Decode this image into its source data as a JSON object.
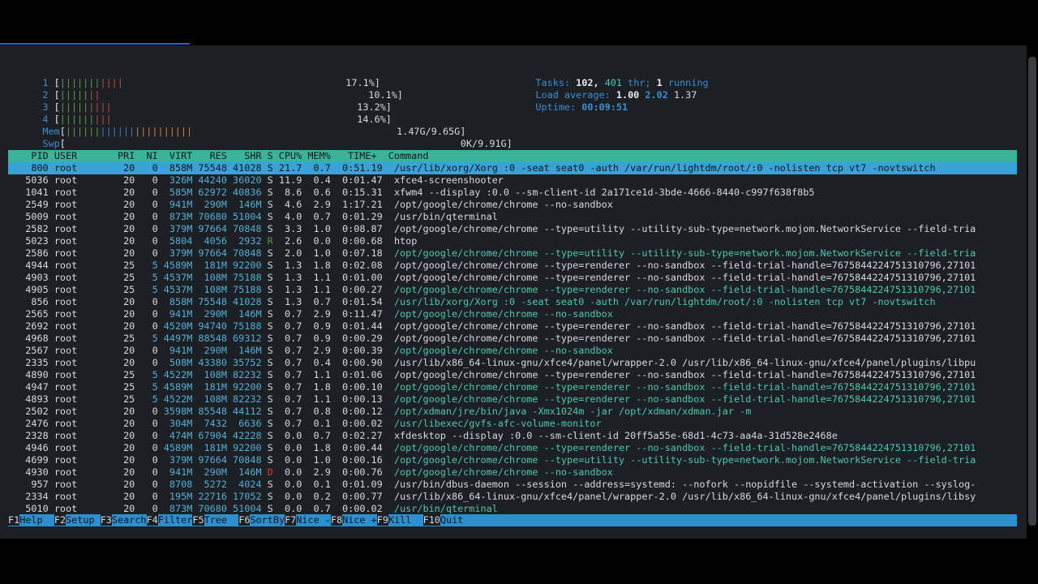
{
  "meters": {
    "cpus": [
      {
        "id": "1",
        "percent": "17.1%]"
      },
      {
        "id": "2",
        "percent": "10.1%]"
      },
      {
        "id": "3",
        "percent": "13.2%]"
      },
      {
        "id": "4",
        "percent": "14.6%]"
      }
    ],
    "mem": {
      "label": "Mem",
      "value": "1.47G/9.65G]"
    },
    "swp": {
      "label": "Swp",
      "value": "0K/9.91G]"
    },
    "tasks_label": "Tasks:",
    "tasks_count": "102,",
    "threads": "401",
    "thr_label": "thr;",
    "running": "1",
    "running_label": "running",
    "load_label": "Load average:",
    "load1": "1.00",
    "load5": "2.02",
    "load15": "1.37",
    "uptime_label": "Uptime:",
    "uptime": "00:09:51"
  },
  "header": "    PID USER       PRI  NI  VIRT   RES   SHR S CPU% MEM%   TIME+  Command",
  "processes": [
    {
      "pid": "800",
      "user": "root",
      "pri": "20",
      "ni": "0",
      "virt": "858M",
      "res": "75548",
      "shr": "41028",
      "s": "S",
      "cpu": "21.7",
      "mem": "0.7",
      "time": "0:51.19",
      "cmd": "/usr/lib/xorg/Xorg :0 -seat seat0 -auth /var/run/lightdm/root/:0 -nolisten tcp vt7 -novtswitch",
      "thread": false,
      "selected": true
    },
    {
      "pid": "5036",
      "user": "root",
      "pri": "20",
      "ni": "0",
      "virt": "326M",
      "res": "44240",
      "shr": "36020",
      "s": "S",
      "cpu": "11.9",
      "mem": "0.4",
      "time": "0:01.47",
      "cmd": "xfce4-screenshooter",
      "thread": false
    },
    {
      "pid": "1041",
      "user": "root",
      "pri": "20",
      "ni": "0",
      "virt": "585M",
      "res": "62972",
      "shr": "40836",
      "s": "S",
      "cpu": "8.6",
      "mem": "0.6",
      "time": "0:15.31",
      "cmd": "xfwm4 --display :0.0 --sm-client-id 2a171ce1d-3bde-4666-8440-c997f638f8b5",
      "thread": false
    },
    {
      "pid": "2549",
      "user": "root",
      "pri": "20",
      "ni": "0",
      "virt": "941M",
      "res": "290M",
      "shr": "146M",
      "s": "S",
      "cpu": "4.6",
      "mem": "2.9",
      "time": "1:17.21",
      "cmd": "/opt/google/chrome/chrome --no-sandbox",
      "thread": false
    },
    {
      "pid": "5009",
      "user": "root",
      "pri": "20",
      "ni": "0",
      "virt": "873M",
      "res": "70680",
      "shr": "51004",
      "s": "S",
      "cpu": "4.0",
      "mem": "0.7",
      "time": "0:01.29",
      "cmd": "/usr/bin/qterminal",
      "thread": false
    },
    {
      "pid": "2582",
      "user": "root",
      "pri": "20",
      "ni": "0",
      "virt": "379M",
      "res": "97664",
      "shr": "70848",
      "s": "S",
      "cpu": "3.3",
      "mem": "1.0",
      "time": "0:08.87",
      "cmd": "/opt/google/chrome/chrome --type=utility --utility-sub-type=network.mojom.NetworkService --field-tria",
      "thread": false
    },
    {
      "pid": "5023",
      "user": "root",
      "pri": "20",
      "ni": "0",
      "virt": "5804",
      "res": "4056",
      "shr": "2932",
      "s": "R",
      "cpu": "2.6",
      "mem": "0.0",
      "time": "0:00.68",
      "cmd": "htop",
      "thread": false
    },
    {
      "pid": "2586",
      "user": "root",
      "pri": "20",
      "ni": "0",
      "virt": "379M",
      "res": "97664",
      "shr": "70848",
      "s": "S",
      "cpu": "2.0",
      "mem": "1.0",
      "time": "0:07.18",
      "cmd": "/opt/google/chrome/chrome --type=utility --utility-sub-type=network.mojom.NetworkService --field-tria",
      "thread": true
    },
    {
      "pid": "4944",
      "user": "root",
      "pri": "25",
      "ni": "5",
      "virt": "4589M",
      "res": "181M",
      "shr": "92200",
      "s": "S",
      "cpu": "1.3",
      "mem": "1.8",
      "time": "0:02.08",
      "cmd": "/opt/google/chrome/chrome --type=renderer --no-sandbox --field-trial-handle=7675844224751310796,27101",
      "thread": false
    },
    {
      "pid": "4903",
      "user": "root",
      "pri": "25",
      "ni": "5",
      "virt": "4537M",
      "res": "108M",
      "shr": "75188",
      "s": "S",
      "cpu": "1.3",
      "mem": "1.1",
      "time": "0:01.00",
      "cmd": "/opt/google/chrome/chrome --type=renderer --no-sandbox --field-trial-handle=7675844224751310796,27101",
      "thread": false
    },
    {
      "pid": "4905",
      "user": "root",
      "pri": "25",
      "ni": "5",
      "virt": "4537M",
      "res": "108M",
      "shr": "75188",
      "s": "S",
      "cpu": "1.3",
      "mem": "1.1",
      "time": "0:00.27",
      "cmd": "/opt/google/chrome/chrome --type=renderer --no-sandbox --field-trial-handle=7675844224751310796,27101",
      "thread": true
    },
    {
      "pid": "856",
      "user": "root",
      "pri": "20",
      "ni": "0",
      "virt": "858M",
      "res": "75548",
      "shr": "41028",
      "s": "S",
      "cpu": "1.3",
      "mem": "0.7",
      "time": "0:01.54",
      "cmd": "/usr/lib/xorg/Xorg :0 -seat seat0 -auth /var/run/lightdm/root/:0 -nolisten tcp vt7 -novtswitch",
      "thread": true
    },
    {
      "pid": "2565",
      "user": "root",
      "pri": "20",
      "ni": "0",
      "virt": "941M",
      "res": "290M",
      "shr": "146M",
      "s": "S",
      "cpu": "0.7",
      "mem": "2.9",
      "time": "0:11.47",
      "cmd": "/opt/google/chrome/chrome --no-sandbox",
      "thread": true
    },
    {
      "pid": "2692",
      "user": "root",
      "pri": "20",
      "ni": "0",
      "virt": "4520M",
      "res": "94740",
      "shr": "75188",
      "s": "S",
      "cpu": "0.7",
      "mem": "0.9",
      "time": "0:01.44",
      "cmd": "/opt/google/chrome/chrome --type=renderer --no-sandbox --field-trial-handle=7675844224751310796,27101",
      "thread": false
    },
    {
      "pid": "4968",
      "user": "root",
      "pri": "25",
      "ni": "5",
      "virt": "4497M",
      "res": "88548",
      "shr": "69312",
      "s": "S",
      "cpu": "0.7",
      "mem": "0.9",
      "time": "0:00.29",
      "cmd": "/opt/google/chrome/chrome --type=renderer --no-sandbox --field-trial-handle=7675844224751310796,27101",
      "thread": false
    },
    {
      "pid": "2567",
      "user": "root",
      "pri": "20",
      "ni": "0",
      "virt": "941M",
      "res": "290M",
      "shr": "146M",
      "s": "S",
      "cpu": "0.7",
      "mem": "2.9",
      "time": "0:00.39",
      "cmd": "/opt/google/chrome/chrome --no-sandbox",
      "thread": true
    },
    {
      "pid": "2335",
      "user": "root",
      "pri": "20",
      "ni": "0",
      "virt": "508M",
      "res": "43380",
      "shr": "35752",
      "s": "S",
      "cpu": "0.7",
      "mem": "0.4",
      "time": "0:00.90",
      "cmd": "/usr/lib/x86_64-linux-gnu/xfce4/panel/wrapper-2.0 /usr/lib/x86_64-linux-gnu/xfce4/panel/plugins/libpu",
      "thread": false
    },
    {
      "pid": "4890",
      "user": "root",
      "pri": "25",
      "ni": "5",
      "virt": "4522M",
      "res": "108M",
      "shr": "82232",
      "s": "S",
      "cpu": "0.7",
      "mem": "1.1",
      "time": "0:01.06",
      "cmd": "/opt/google/chrome/chrome --type=renderer --no-sandbox --field-trial-handle=7675844224751310796,27101",
      "thread": false
    },
    {
      "pid": "4947",
      "user": "root",
      "pri": "25",
      "ni": "5",
      "virt": "4589M",
      "res": "181M",
      "shr": "92200",
      "s": "S",
      "cpu": "0.7",
      "mem": "1.8",
      "time": "0:00.10",
      "cmd": "/opt/google/chrome/chrome --type=renderer --no-sandbox --field-trial-handle=7675844224751310796,27101",
      "thread": true
    },
    {
      "pid": "4893",
      "user": "root",
      "pri": "25",
      "ni": "5",
      "virt": "4522M",
      "res": "108M",
      "shr": "82232",
      "s": "S",
      "cpu": "0.7",
      "mem": "1.1",
      "time": "0:00.13",
      "cmd": "/opt/google/chrome/chrome --type=renderer --no-sandbox --field-trial-handle=7675844224751310796,27101",
      "thread": true
    },
    {
      "pid": "2502",
      "user": "root",
      "pri": "20",
      "ni": "0",
      "virt": "3598M",
      "res": "85548",
      "shr": "44112",
      "s": "S",
      "cpu": "0.7",
      "mem": "0.8",
      "time": "0:00.12",
      "cmd": "/opt/xdman/jre/bin/java -Xmx1024m -jar /opt/xdman/xdman.jar -m",
      "thread": true
    },
    {
      "pid": "2476",
      "user": "root",
      "pri": "20",
      "ni": "0",
      "virt": "304M",
      "res": "7432",
      "shr": "6636",
      "s": "S",
      "cpu": "0.7",
      "mem": "0.1",
      "time": "0:00.02",
      "cmd": "/usr/libexec/gvfs-afc-volume-monitor",
      "thread": true
    },
    {
      "pid": "2328",
      "user": "root",
      "pri": "20",
      "ni": "0",
      "virt": "474M",
      "res": "67904",
      "shr": "42228",
      "s": "S",
      "cpu": "0.0",
      "mem": "0.7",
      "time": "0:02.27",
      "cmd": "xfdesktop --display :0.0 --sm-client-id 20ff5a55e-68d1-4c73-aa4a-31d528e2468e",
      "thread": false
    },
    {
      "pid": "4946",
      "user": "root",
      "pri": "20",
      "ni": "0",
      "virt": "4589M",
      "res": "181M",
      "shr": "92200",
      "s": "S",
      "cpu": "0.0",
      "mem": "1.8",
      "time": "0:00.44",
      "cmd": "/opt/google/chrome/chrome --type=renderer --no-sandbox --field-trial-handle=7675844224751310796,27101",
      "thread": true
    },
    {
      "pid": "4699",
      "user": "root",
      "pri": "20",
      "ni": "0",
      "virt": "379M",
      "res": "97664",
      "shr": "70848",
      "s": "S",
      "cpu": "0.0",
      "mem": "1.0",
      "time": "0:00.16",
      "cmd": "/opt/google/chrome/chrome --type=utility --utility-sub-type=network.mojom.NetworkService --field-tria",
      "thread": true
    },
    {
      "pid": "4930",
      "user": "root",
      "pri": "20",
      "ni": "0",
      "virt": "941M",
      "res": "290M",
      "shr": "146M",
      "s": "D",
      "cpu": "0.0",
      "mem": "2.9",
      "time": "0:00.76",
      "cmd": "/opt/google/chrome/chrome --no-sandbox",
      "thread": true
    },
    {
      "pid": "957",
      "user": "root",
      "pri": "20",
      "ni": "0",
      "virt": "8708",
      "res": "5272",
      "shr": "4024",
      "s": "S",
      "cpu": "0.0",
      "mem": "0.1",
      "time": "0:01.09",
      "cmd": "/usr/bin/dbus-daemon --session --address=systemd: --nofork --nopidfile --systemd-activation --syslog-",
      "thread": false
    },
    {
      "pid": "2334",
      "user": "root",
      "pri": "20",
      "ni": "0",
      "virt": "195M",
      "res": "22716",
      "shr": "17052",
      "s": "S",
      "cpu": "0.0",
      "mem": "0.2",
      "time": "0:00.77",
      "cmd": "/usr/lib/x86_64-linux-gnu/xfce4/panel/wrapper-2.0 /usr/lib/x86_64-linux-gnu/xfce4/panel/plugins/libsy",
      "thread": false
    },
    {
      "pid": "5010",
      "user": "root",
      "pri": "20",
      "ni": "0",
      "virt": "873M",
      "res": "70680",
      "shr": "51004",
      "s": "S",
      "cpu": "0.0",
      "mem": "0.7",
      "time": "0:00.02",
      "cmd": "/usr/bin/qterminal",
      "thread": true
    }
  ],
  "fkeys": [
    {
      "key": "F1",
      "label": "Help  "
    },
    {
      "key": "F2",
      "label": "Setup "
    },
    {
      "key": "F3",
      "label": "Search"
    },
    {
      "key": "F4",
      "label": "Filter"
    },
    {
      "key": "F5",
      "label": "Tree  "
    },
    {
      "key": "F6",
      "label": "SortBy"
    },
    {
      "key": "F7",
      "label": "Nice -"
    },
    {
      "key": "F8",
      "label": "Nice +"
    },
    {
      "key": "F9",
      "label": "Kill  "
    },
    {
      "key": "F10",
      "label": "Quit"
    }
  ],
  "colors": {
    "header_bg": "#39b39a",
    "selected_bg": "#37a3d8",
    "fkey_bg": "#2d8fce",
    "thread_text": "#4cc9b0"
  }
}
